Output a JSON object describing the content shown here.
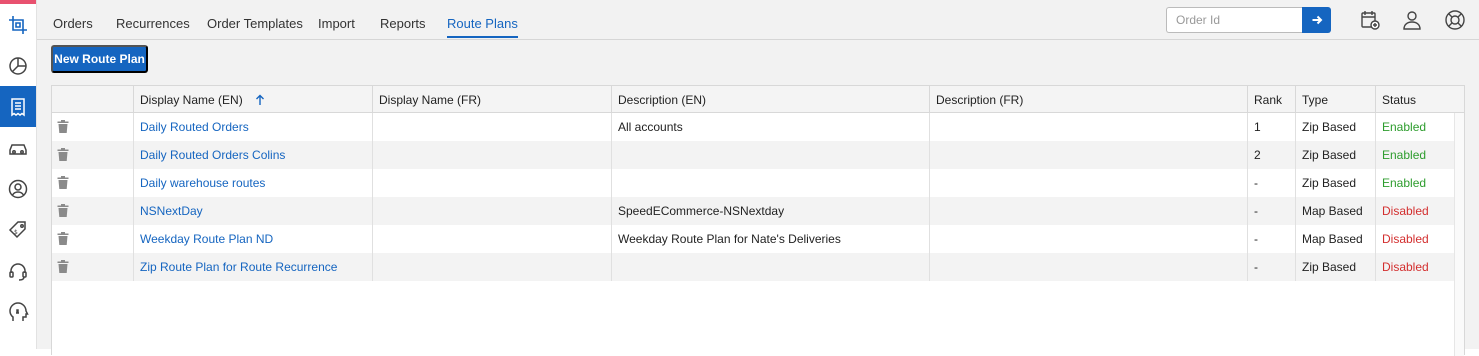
{
  "nav": {
    "tabs": [
      "Orders",
      "Recurrences",
      "Order Templates",
      "Import",
      "Reports",
      "Route Plans"
    ],
    "active_tab": "Route Plans"
  },
  "search": {
    "placeholder": "Order Id"
  },
  "icons": {
    "sidebar": [
      "crop-logo-icon",
      "pie-chart-icon",
      "receipt-icon",
      "car-icon",
      "user-circle-icon",
      "price-tag-icon",
      "headset-icon",
      "head-gears-icon"
    ],
    "topbar": [
      "calendar-add-icon",
      "user-icon",
      "lifebuoy-icon"
    ]
  },
  "toolbar": {
    "new_button": "New Route Plan"
  },
  "table": {
    "columns": [
      "",
      "Display Name (EN)",
      "Display Name (FR)",
      "Description (EN)",
      "Description (FR)",
      "Rank",
      "Type",
      "Status"
    ],
    "sort_column": "Display Name (EN)",
    "sort_direction": "ascending",
    "rows": [
      {
        "name_en": "Daily Routed Orders",
        "name_fr": "",
        "desc_en": "All accounts",
        "desc_fr": "",
        "rank": "1",
        "type": "Zip Based",
        "status": "Enabled"
      },
      {
        "name_en": "Daily Routed Orders Colins",
        "name_fr": "",
        "desc_en": "",
        "desc_fr": "",
        "rank": "2",
        "type": "Zip Based",
        "status": "Enabled"
      },
      {
        "name_en": "Daily warehouse routes",
        "name_fr": "",
        "desc_en": "",
        "desc_fr": "",
        "rank": "-",
        "type": "Zip Based",
        "status": "Enabled"
      },
      {
        "name_en": "NSNextDay",
        "name_fr": "",
        "desc_en": "SpeedECommerce-NSNextday",
        "desc_fr": "",
        "rank": "-",
        "type": "Map Based",
        "status": "Disabled"
      },
      {
        "name_en": "Weekday Route Plan ND",
        "name_fr": "",
        "desc_en": "Weekday Route Plan for Nate's Deliveries",
        "desc_fr": "",
        "rank": "-",
        "type": "Map Based",
        "status": "Disabled"
      },
      {
        "name_en": "Zip Route Plan for Route Recurrence",
        "name_fr": "",
        "desc_en": "",
        "desc_fr": "",
        "rank": "-",
        "type": "Zip Based",
        "status": "Disabled"
      }
    ]
  },
  "colors": {
    "accent": "#1565c0",
    "enabled": "#2e9d2e",
    "disabled": "#d32f2f",
    "brand_bar": "#e8516f"
  }
}
